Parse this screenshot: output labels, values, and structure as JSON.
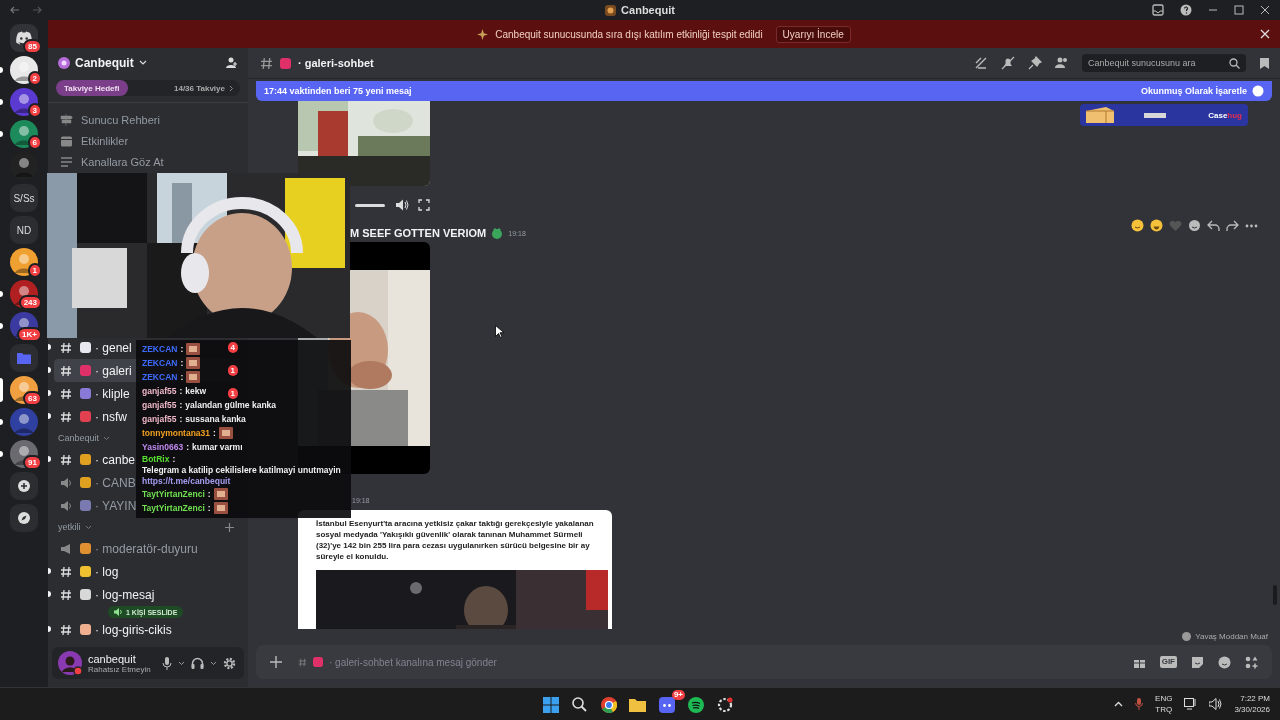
{
  "window": {
    "title": "Canbequit"
  },
  "alert": {
    "text": "Canbequit sunucusunda sıra dışı katılım etkinliği tespit edildi",
    "button": "Uyarıyı İncele"
  },
  "servers": [
    {
      "kind": "home",
      "badge": "85",
      "unread": false,
      "selected": false
    },
    {
      "kind": "avatar",
      "badge": "2",
      "unread": true,
      "selected": false
    },
    {
      "kind": "avatar",
      "badge": "3",
      "unread": true,
      "selected": false
    },
    {
      "kind": "avatar",
      "badge": "6",
      "unread": true,
      "selected": false
    },
    {
      "kind": "avatar",
      "unread": false,
      "selected": false
    },
    {
      "kind": "text",
      "label": "S/Ss",
      "unread": false,
      "selected": false
    },
    {
      "kind": "text",
      "label": "ND",
      "unread": false,
      "selected": false
    },
    {
      "kind": "avatar",
      "badge": "1",
      "unread": false,
      "selected": false
    },
    {
      "kind": "avatar",
      "badge": "243",
      "unread": true,
      "selected": false
    },
    {
      "kind": "avatar",
      "badge": "1K+",
      "unread": true,
      "selected": false
    },
    {
      "kind": "folder",
      "unread": false,
      "selected": false
    },
    {
      "kind": "avatar",
      "badge": "63",
      "unread": false,
      "selected": true
    },
    {
      "kind": "avatar",
      "unread": true,
      "selected": false
    },
    {
      "kind": "avatar",
      "badge": "91",
      "unread": true,
      "selected": false
    },
    {
      "kind": "add",
      "unread": false,
      "selected": false
    },
    {
      "kind": "discover",
      "unread": false,
      "selected": false
    }
  ],
  "server": {
    "name": "Canbequit",
    "boost_label": "Takviye Hedefi",
    "boost_count": "14/36 Takviye",
    "level": 0.39
  },
  "nav": [
    {
      "kind": "guide",
      "label": "Sunucu Rehberi"
    },
    {
      "kind": "events",
      "label": "Etkinlikler"
    },
    {
      "kind": "browse",
      "label": "Kanallara Göz At"
    }
  ],
  "sections": [
    {
      "channels": [
        {
          "kind": "text",
          "color": "#e8e8f0",
          "name": "· genel",
          "badge": "4",
          "unread": true,
          "selected": false
        },
        {
          "kind": "text",
          "color": "#e0306a",
          "name": "· galeri",
          "badge": "1",
          "unread": true,
          "selected": true
        },
        {
          "kind": "text",
          "color": "#8a7ad8",
          "name": "· kliple",
          "badge": "1",
          "unread": true,
          "selected": false
        },
        {
          "kind": "text",
          "color": "#e04050",
          "name": "· nsfw",
          "unread": true,
          "selected": false
        }
      ]
    },
    {
      "category": "Canbequit",
      "channels": [
        {
          "kind": "text",
          "color": "#e0a020",
          "name": "· canbe",
          "unread": true,
          "selected": false
        },
        {
          "kind": "voice",
          "color": "#e0a020",
          "name": "· CANB",
          "unread": false,
          "selected": false
        },
        {
          "kind": "voice",
          "color": "#7a7ab0",
          "name": "· YAYIN",
          "unread": false,
          "selected": false
        }
      ]
    },
    {
      "category": "yetkili",
      "add": true,
      "channels": [
        {
          "kind": "announce",
          "color": "#e09030",
          "name": "· moderatör-duyuru",
          "unread": false,
          "selected": false
        },
        {
          "kind": "text",
          "color": "#f0c030",
          "name": "· log",
          "unread": true,
          "selected": false
        },
        {
          "kind": "text",
          "color": "#d8d8d8",
          "name": "· log-mesaj",
          "unread": true,
          "selected": false,
          "voice_pill": "1 KİŞİ SESLİDE"
        },
        {
          "kind": "text",
          "color": "#f0b090",
          "name": "· log-giris-cikis",
          "unread": true,
          "selected": false
        }
      ]
    }
  ],
  "user": {
    "name": "canbequit",
    "status": "Rahatsız Etmeyin"
  },
  "channel_header": {
    "name": "· galeri-sohbet",
    "search_placeholder": "Canbequit sunucusunu ara"
  },
  "new_messages": {
    "text": "17:44 vaktinden beri 75 yeni mesaj",
    "action": "Okunmuş Olarak İşaretle"
  },
  "messages": [
    {
      "kind": "video",
      "controls": true
    },
    {
      "kind": "video",
      "controls": false,
      "text": "M SEEF GOTTEN VERIOM",
      "time": "19:18",
      "toolbar": true
    },
    {
      "kind": "embed",
      "time": "19:18",
      "embed_text": "İstanbul Esenyurt'ta aracına yetkisiz çakar taktığı gerekçesiyle yakalanan sosyal medyada 'Yakışıklı güvenlik' olarak tanınan Muhammet Sürmeli (32)'ye 142 bin 255 lira para cezası uygulanırken sürücü belgesine bir ay süreyle el konuldu."
    }
  ],
  "composer": {
    "placeholder": "· galeri-sohbet kanalına mesaj gönder",
    "slowmode": "Yavaş Moddan Muaf",
    "gif_label": "GIF"
  },
  "stream_chat": [
    {
      "user": "ZEKCAN",
      "sep": ":",
      "color": "#3d6bff",
      "emote": true
    },
    {
      "user": "ZEKCAN",
      "sep": ":",
      "color": "#3d6bff",
      "emote": true
    },
    {
      "user": "ZEKCAN",
      "sep": ":",
      "color": "#3d6bff",
      "emote": true
    },
    {
      "user": "ganjaf55",
      "sep": ":",
      "color": "#f0b8c8",
      "text": "kekw",
      "emote": false
    },
    {
      "user": "ganjaf55",
      "sep": ":",
      "color": "#f0b8c8",
      "text": "yalandan gülme kanka",
      "emote": false
    },
    {
      "user": "ganjaf55",
      "sep": ":",
      "color": "#f0b8c8",
      "text": "sussana kanka",
      "emote": false
    },
    {
      "user": "tonnymontana31",
      "sep": ":",
      "color": "#f0a020",
      "emote": true
    },
    {
      "user": "Yasin0663",
      "sep": ":",
      "color": "#c08af0",
      "text": "kumar varmı",
      "emote": false
    },
    {
      "user": "BotRix",
      "sep": ":",
      "color": "#58e030",
      "text": "Telegram a katilip cekilislere katilmayi unutmayin",
      "link": "https://t.me/canbequit",
      "emote": false
    },
    {
      "user": "TaytYirtanZenci",
      "sep": ":",
      "color": "#70e050",
      "emote": true
    },
    {
      "user": "TaytYirtanZenci",
      "sep": ":",
      "color": "#70e050",
      "emote": true
    }
  ],
  "ad": {
    "brand": "Case",
    "brand_accent": "hug"
  },
  "taskbar": {
    "apps": [
      {
        "kind": "windows"
      },
      {
        "kind": "search"
      },
      {
        "kind": "chrome"
      },
      {
        "kind": "folder"
      },
      {
        "kind": "discord",
        "badge": "9+"
      },
      {
        "kind": "spotify"
      },
      {
        "kind": "app"
      }
    ],
    "lang_top": "ENG",
    "lang_bottom": "TRQ",
    "time": "7:22 PM",
    "date": "3/30/2026"
  }
}
